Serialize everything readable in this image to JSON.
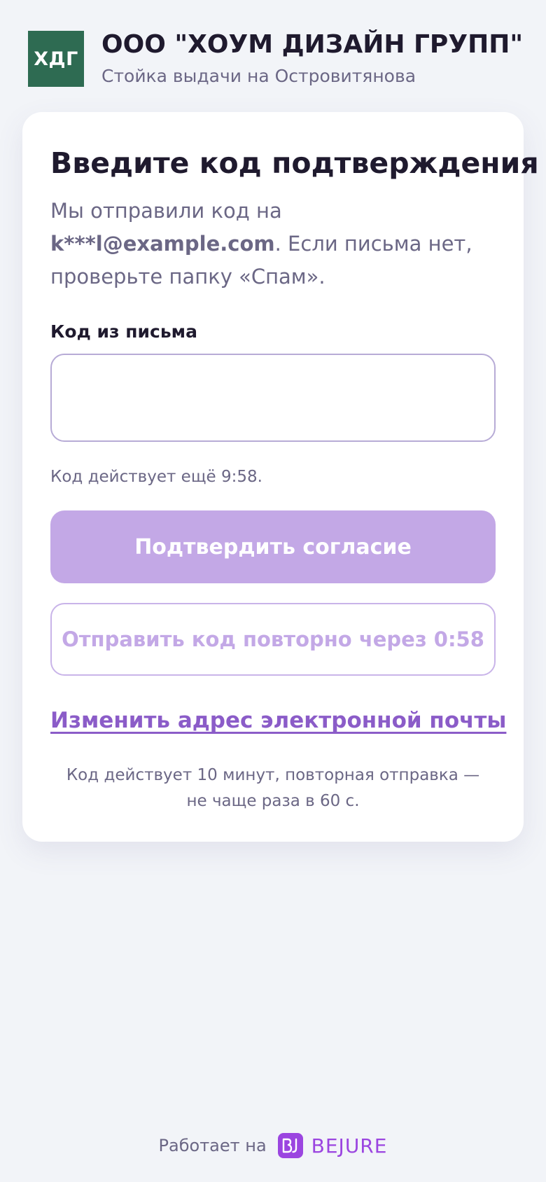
{
  "header": {
    "logo_text": "ХДГ",
    "logo_color": "#2e6b52",
    "company_name": "ООО \"ХОУМ ДИЗАЙН ГРУПП\"",
    "subtitle": "Стойка выдачи на Островитянова"
  },
  "card": {
    "title": "Введите код подтверждения",
    "description_prefix": "Мы отправили код на",
    "email": "k***l@example.com",
    "description_suffix": ". Если письма нет, проверьте папку «Спам».",
    "code_label": "Код из письма",
    "code_value": "",
    "code_placeholder": "",
    "timer_text": "Код действует ещё 9:58.",
    "confirm_button": "Подтвердить согласие",
    "resend_button": "Отправить код повторно через 0:58",
    "change_email_link": "Изменить адрес электронной почты",
    "note": "Код действует 10 минут, повторная отправка — не чаще раза в 60 с."
  },
  "footer": {
    "powered_by": "Работает на",
    "brand_name": "BEJURE",
    "brand_icon": "bejure-logo-icon",
    "brand_color": "#9b45e0"
  },
  "colors": {
    "accent": "#8b5cc8",
    "primary_button_disabled": "#c3a8e6",
    "background": "#f2f4f8"
  }
}
